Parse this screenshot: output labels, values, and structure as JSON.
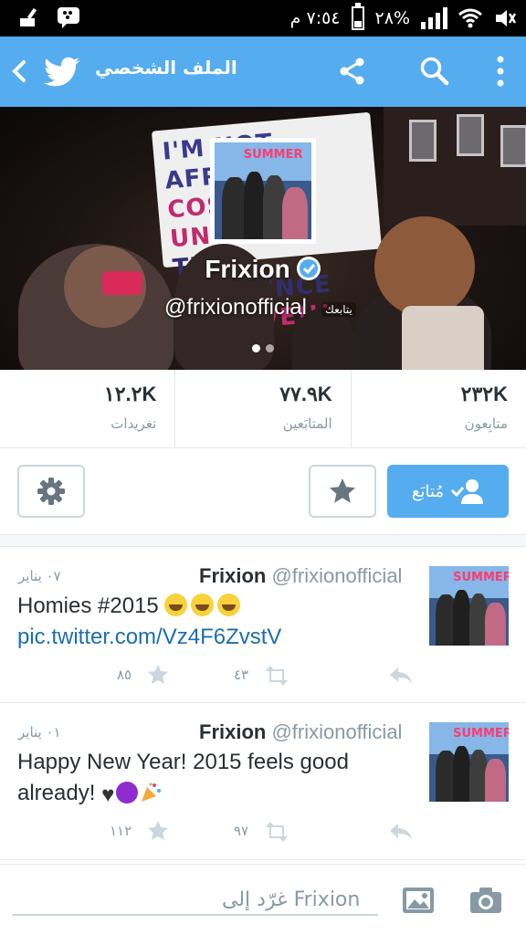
{
  "status_bar": {
    "time": "٧:٥٤ م",
    "battery": "٢٨%"
  },
  "app_bar": {
    "title": "الملف الشخصي"
  },
  "profile": {
    "display_name": "Frixion",
    "handle": "@frixionofficial",
    "follows_you": "يتابعك",
    "carousel_active_index": 1,
    "carousel_count": 2
  },
  "stats": [
    {
      "value": "٢٣٢K",
      "label": "متابِعون"
    },
    {
      "value": "٧٧.٩K",
      "label": "المتابَعين"
    },
    {
      "value": "١٢.٢K",
      "label": "تغريدات"
    }
  ],
  "actions": {
    "follow_label": "مُتابَع"
  },
  "tweets": [
    {
      "author": "Frixion",
      "handle": "@frixionofficial",
      "date": "٠٧ يناير",
      "text": "Homies #2015",
      "link": "pic.twitter.com/Vz4F6ZvstV",
      "retweets": "٤٣",
      "favorites": "٨٥"
    },
    {
      "author": "Frixion",
      "handle": "@frixionofficial",
      "date": "٠١ يناير",
      "text_line1": "Happy New Year! 2015 feels good",
      "text_line2": "already!",
      "retweets": "٩٧",
      "favorites": "١١٢"
    }
  ],
  "banner_photo": {
    "sign_lines": [
      "I'M NOT AFRAID",
      "COS IT'S UNDER",
      "THE INFLUENCE",
      "OF LOVE!!!"
    ]
  },
  "compose": {
    "placeholder": "غرّد إلى Frixion"
  },
  "colors": {
    "brand": "#55acee",
    "link": "#1b6db3",
    "muted": "#8899a6"
  },
  "icons": [
    "broom-icon",
    "bbm-icon",
    "mute-icon",
    "wifi-icon",
    "signal-icon",
    "battery-icon",
    "back-icon",
    "twitter-bird-icon",
    "share-icon",
    "search-icon",
    "more-icon",
    "verified-icon",
    "gear-icon",
    "star-icon",
    "follow-user-icon",
    "retweet-icon",
    "reply-icon",
    "camera-icon",
    "image-icon"
  ]
}
